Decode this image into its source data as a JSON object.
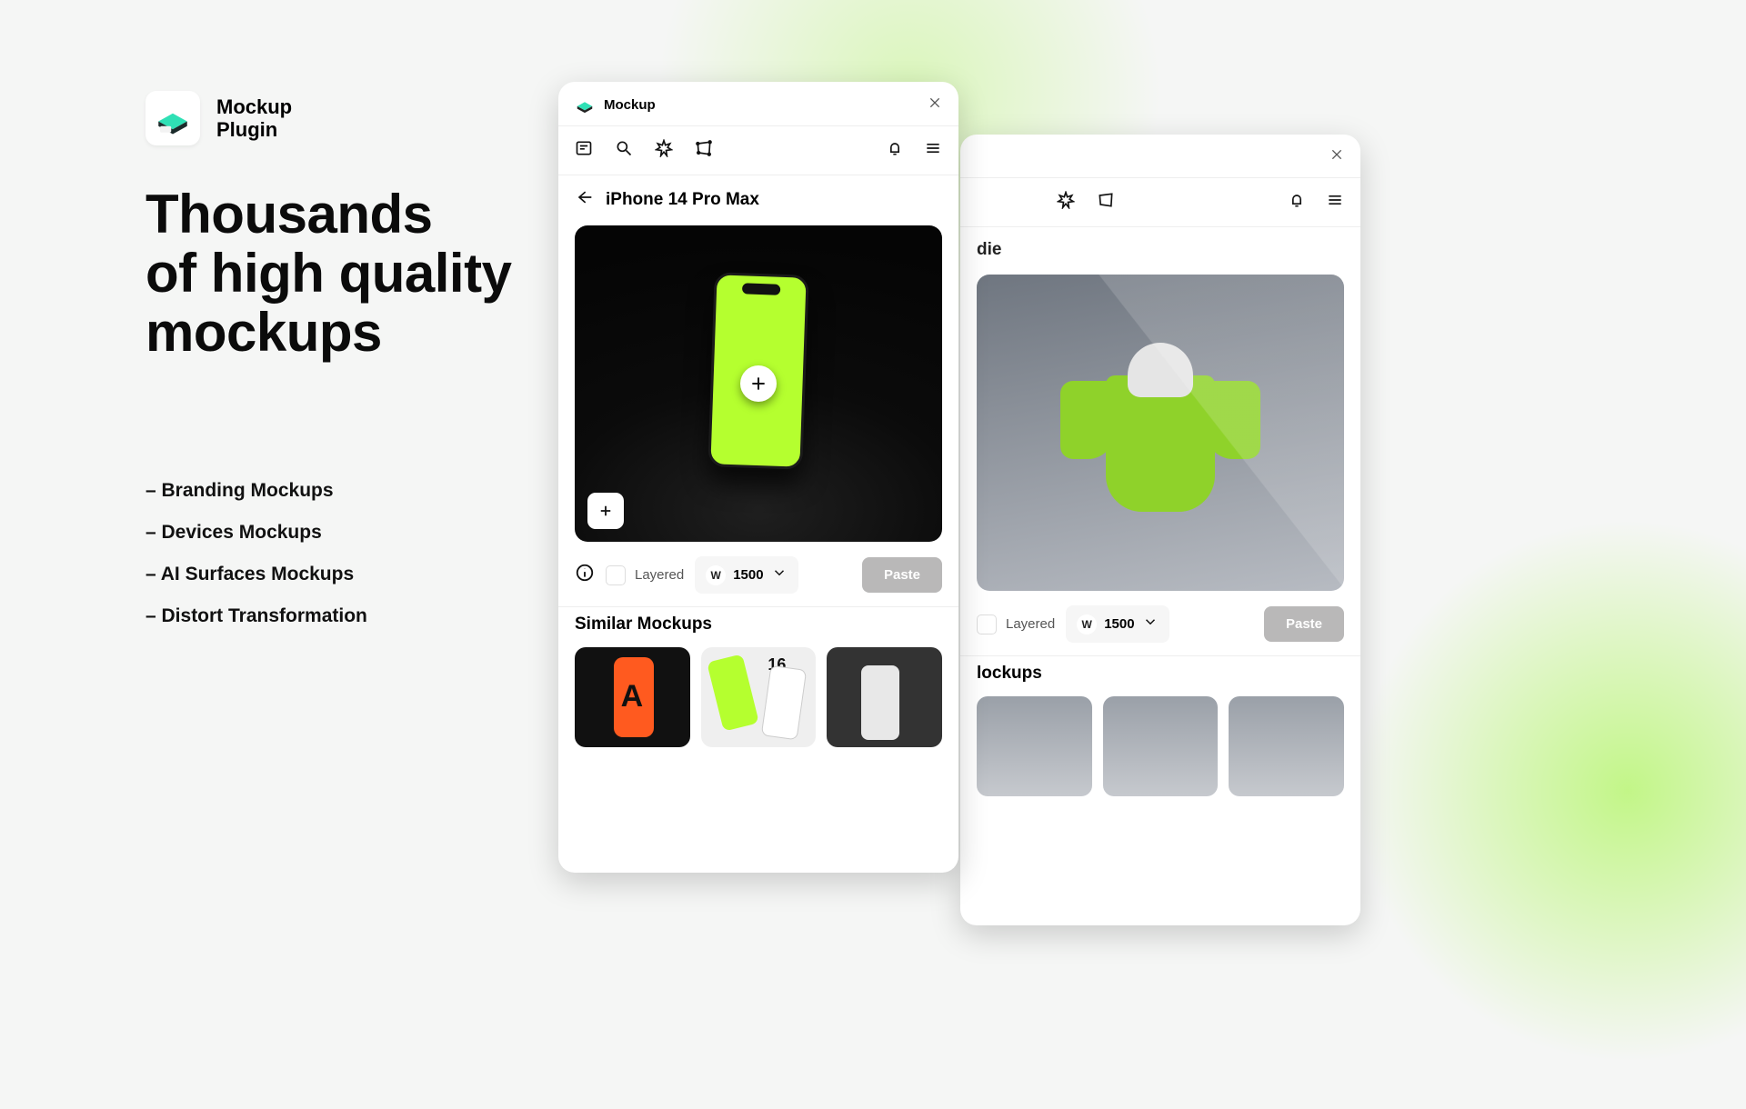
{
  "brand": {
    "line1": "Mockup",
    "line2": "Plugin"
  },
  "headline": "Thousands\nof high quality\nmockups",
  "features": [
    "– Branding Mockups",
    "– Devices Mockups",
    "– AI Surfaces Mockups",
    "– Distort Transformation"
  ],
  "card_front": {
    "title": "Mockup",
    "breadcrumb": "iPhone 14 Pro Max",
    "controls": {
      "layered_label": "Layered",
      "width_prefix": "W",
      "width_value": "1500",
      "paste_label": "Paste"
    },
    "similar_label": "Similar Mockups"
  },
  "card_back": {
    "breadcrumb_suffix": "die",
    "controls": {
      "layered_label": "Layered",
      "width_prefix": "W",
      "width_value": "1500",
      "paste_label": "Paste"
    },
    "similar_suffix": "lockups"
  },
  "colors": {
    "accent": "#b5ff2f"
  }
}
